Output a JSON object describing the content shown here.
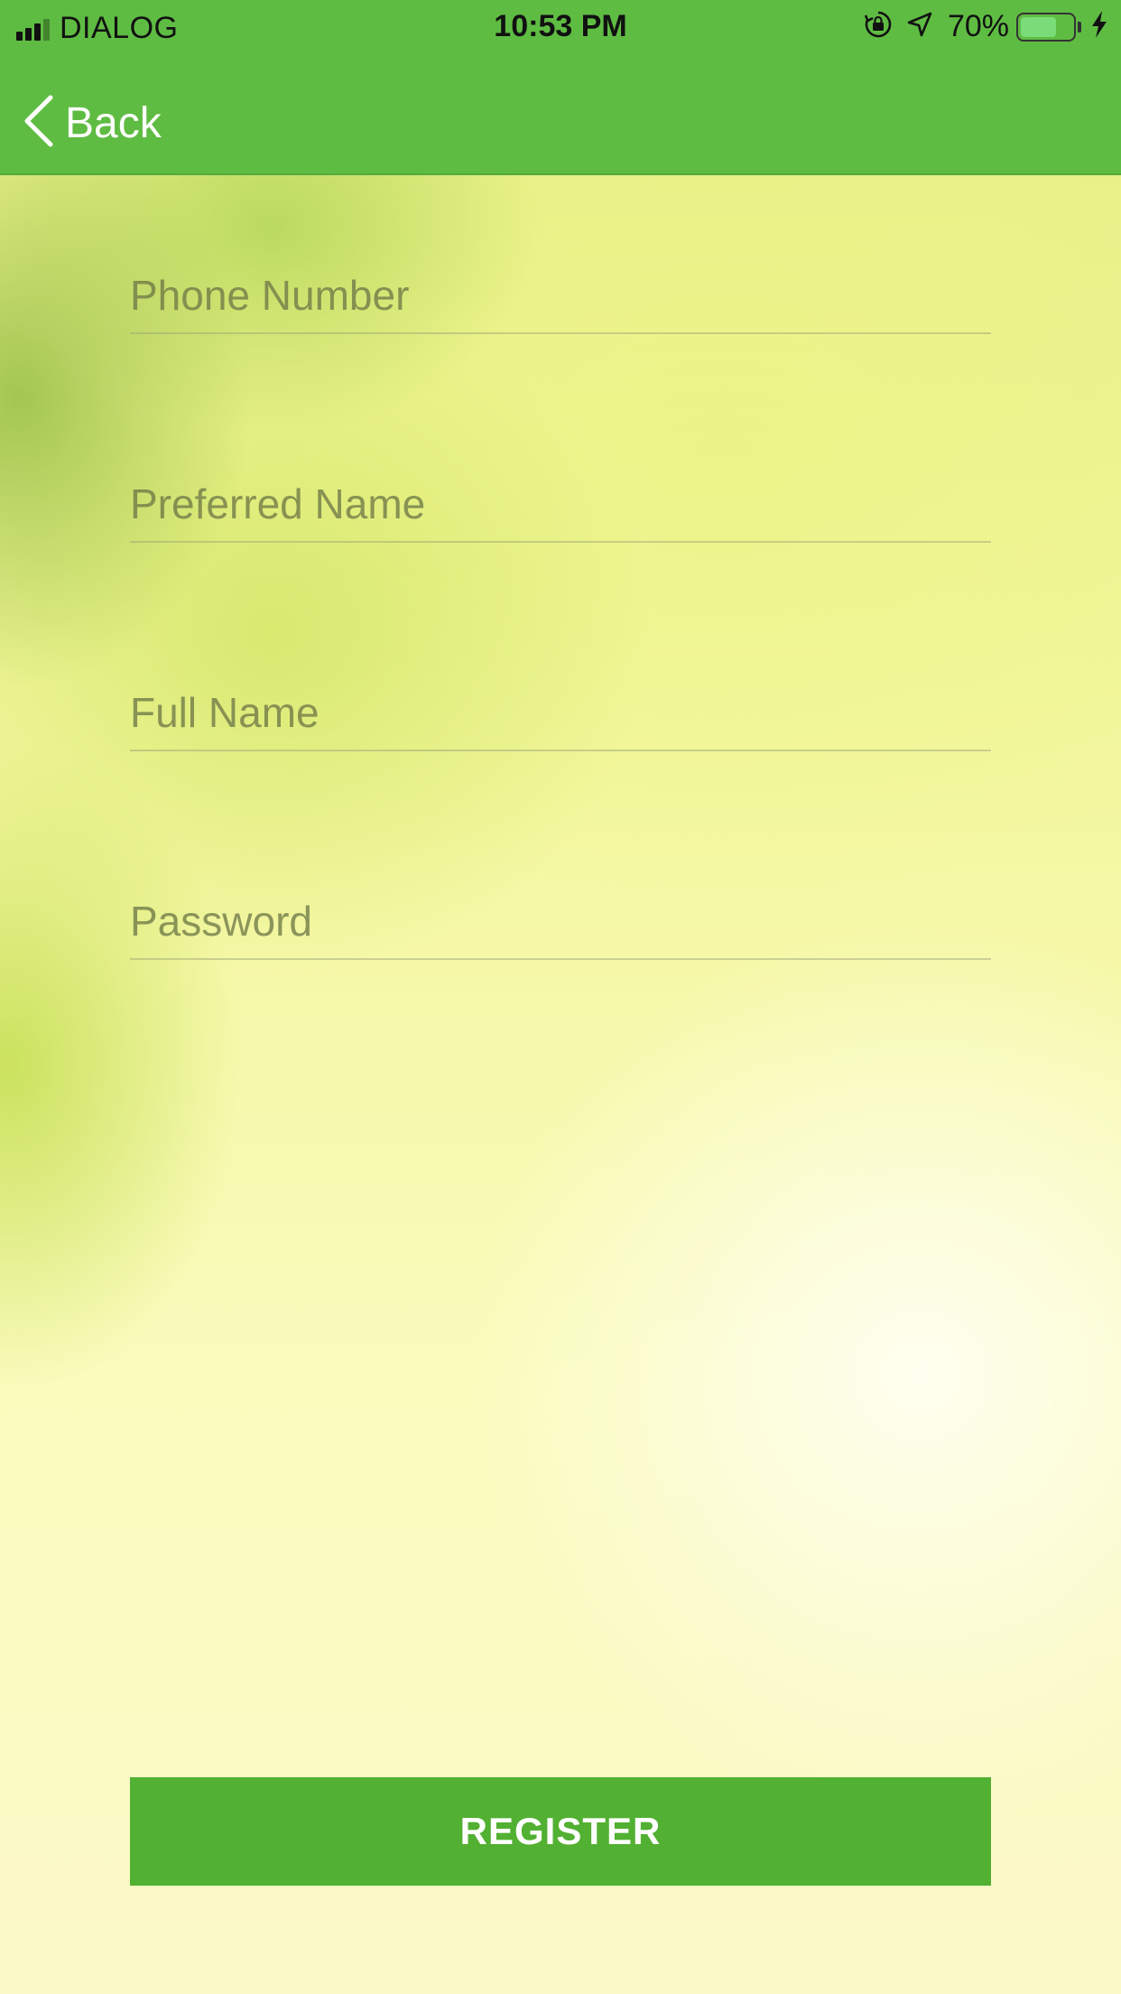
{
  "status_bar": {
    "carrier": "DIALOG",
    "time": "10:53 PM",
    "battery_percent": "70%",
    "battery_level": 0.7,
    "icons": [
      "signal-icon",
      "rotation-lock-icon",
      "location-arrow-icon",
      "battery-icon",
      "charging-bolt-icon"
    ]
  },
  "nav": {
    "back_label": "Back",
    "back_icon": "chevron-left-icon",
    "bar_color": "#5fbc43"
  },
  "form": {
    "phone": {
      "placeholder": "Phone Number",
      "value": ""
    },
    "preferred_name": {
      "placeholder": "Preferred Name",
      "value": ""
    },
    "full_name": {
      "placeholder": "Full Name",
      "value": ""
    },
    "password": {
      "placeholder": "Password",
      "value": ""
    }
  },
  "register": {
    "label": "REGISTER",
    "color": "#52b032"
  }
}
